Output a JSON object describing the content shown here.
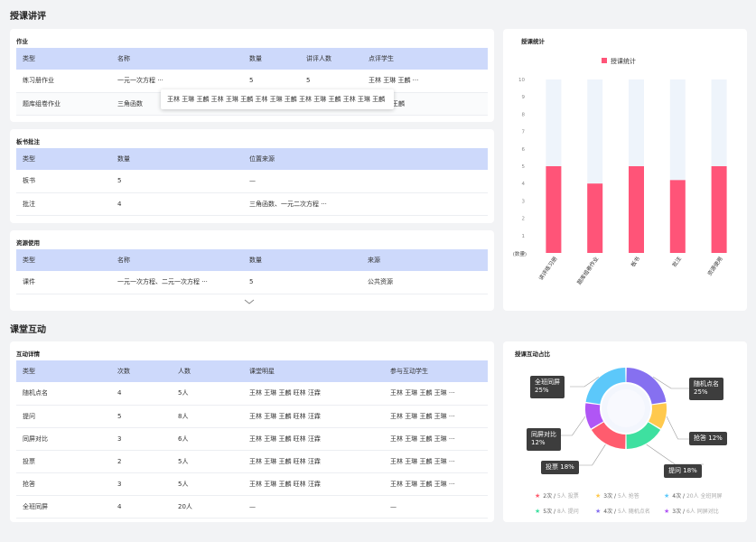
{
  "section1_title": "授课讲评",
  "section2_title": "课堂互动",
  "homework": {
    "title": "作业",
    "columns": [
      "类型",
      "名称",
      "数量",
      "讲评人数",
      "点评学生"
    ],
    "rows": [
      [
        "练习册作业",
        "一元一次方程 ···",
        "5",
        "5",
        "王林 王琳 王麟 ···"
      ],
      [
        "题库组卷作业",
        "三角函数",
        "",
        "",
        "王麟"
      ]
    ],
    "tooltip": "王林 王琳 王麟  王林 王琳 王麟  王林 王琳 王麟  王林 王琳 王麟  王林 王琳 王麟"
  },
  "board": {
    "title": "板书批注",
    "columns": [
      "类型",
      "数量",
      "位置来源"
    ],
    "rows": [
      [
        "板书",
        "5",
        "—"
      ],
      [
        "批注",
        "4",
        "三角函数、一元二次方程 ···"
      ]
    ]
  },
  "resource": {
    "title": "资源使用",
    "columns": [
      "类型",
      "名称",
      "数量",
      "来源"
    ],
    "rows": [
      [
        "课件",
        "一元一次方程、二元一次方程 ···",
        "5",
        "公共资源"
      ]
    ]
  },
  "interaction": {
    "title": "互动详情",
    "columns": [
      "类型",
      "次数",
      "人数",
      "课堂明星",
      "参与互动学生"
    ],
    "rows": [
      [
        "随机点名",
        "4",
        "5人",
        "王林 王琳 王麟 旺林 汪霖",
        "王林 王琳 王麟 王琳 ···"
      ],
      [
        "提问",
        "5",
        "8人",
        "王林 王琳 王麟 旺林 汪霖",
        "王林 王琳 王麟 王琳 ···"
      ],
      [
        "同屏对比",
        "3",
        "6人",
        "王林 王琳 王麟 旺林 汪霖",
        "王林 王琳 王麟 王琳 ···"
      ],
      [
        "投票",
        "2",
        "5人",
        "王林 王琳 王麟 旺林 汪霖",
        "王林 王琳 王麟 王琳 ···"
      ],
      [
        "抢答",
        "3",
        "5人",
        "王林 王琳 王麟 旺林 汪霖",
        "王林 王琳 王麟 王琳 ···"
      ],
      [
        "全班同屏",
        "4",
        "20人",
        "—",
        "—"
      ]
    ]
  },
  "teaching_stats": {
    "title": "授课统计",
    "ylabel": "(数量)"
  },
  "interaction_ratio": {
    "title": "授课互动占比",
    "callouts": [
      {
        "name": "全班同屏",
        "pct": "25%"
      },
      {
        "name": "随机点名",
        "pct": "25%"
      },
      {
        "name": "抢答",
        "pct": "12%"
      },
      {
        "name": "提问",
        "pct": "18%"
      },
      {
        "name": "投票",
        "pct": "18%"
      },
      {
        "name": "同屏对比",
        "pct": "12%"
      }
    ],
    "legend": [
      {
        "count": "2次",
        "people": "5人",
        "name": "投票",
        "color": "#ff5c6e"
      },
      {
        "count": "3次",
        "people": "5人",
        "name": "抢答",
        "color": "#ffc94d"
      },
      {
        "count": "4次",
        "people": "20人",
        "name": "全班同屏",
        "color": "#5cc8fa"
      },
      {
        "count": "5次",
        "people": "8人",
        "name": "提问",
        "color": "#3ee0a0"
      },
      {
        "count": "4次",
        "people": "5人",
        "name": "随机点名",
        "color": "#8670f0"
      },
      {
        "count": "3次",
        "people": "6人",
        "name": "同屏对比",
        "color": "#b056f5"
      }
    ]
  },
  "chart_data": [
    {
      "type": "bar",
      "title": "授课统计",
      "ylabel": "(数量)",
      "ylim": [
        0,
        10
      ],
      "yticks": [
        "0",
        "1",
        "2",
        "3",
        "4",
        "5",
        "6",
        "7",
        "8",
        "9",
        "10"
      ],
      "categories": [
        "讲评练习册",
        "题库组卷作业",
        "板书",
        "批注",
        "资源使用"
      ],
      "series": [
        {
          "name": "授课统计",
          "values": [
            5,
            4,
            5,
            4.2,
            5
          ],
          "color": "#ff5478"
        }
      ],
      "legend_position": "top"
    },
    {
      "type": "pie",
      "title": "授课互动占比",
      "labels": [
        "随机点名",
        "抢答",
        "提问",
        "投票",
        "同屏对比",
        "全班同屏"
      ],
      "values": [
        25,
        12,
        18,
        18,
        12,
        25
      ],
      "colors": [
        "#8670f0",
        "#ffc94d",
        "#3ee0a0",
        "#ff5c6e",
        "#b056f5",
        "#5cc8fa"
      ]
    }
  ]
}
